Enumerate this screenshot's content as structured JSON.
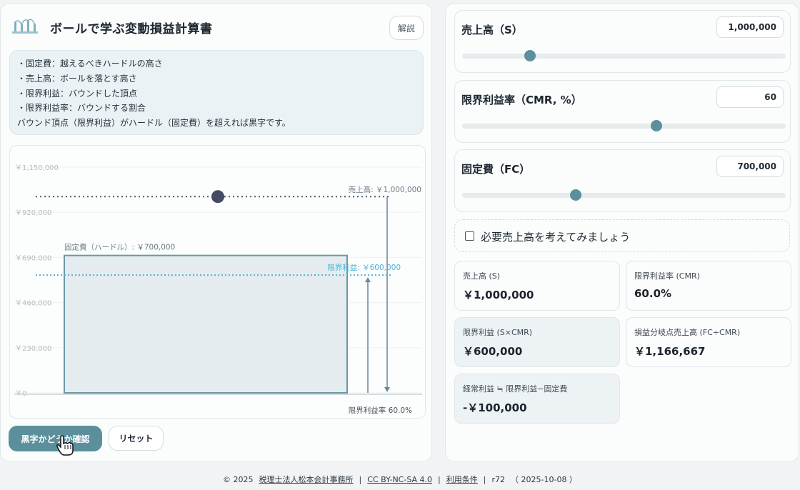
{
  "header": {
    "title": "ボールで学ぶ変動損益計算書",
    "help_label": "解説"
  },
  "info": {
    "lines": [
      "・固定費：越えるべきハードルの高さ",
      "・売上高：ボールを落とす高さ",
      "・限界利益：バウンドした頂点",
      "・限界利益率：バウンドする割合",
      "バウンド頂点（限界利益）がハードル（固定費）を超えれば黒字です。"
    ]
  },
  "chart_data": {
    "type": "bar",
    "y_ticks": [
      "￥1,150,000",
      "￥920,000",
      "￥690,000",
      "￥460,000",
      "￥230,000",
      "￥0"
    ],
    "ylim": [
      0,
      1150000
    ],
    "sales": 1000000,
    "marginal_profit": 600000,
    "fixed_cost": 700000,
    "labels": {
      "sales": "売上高: ￥1,000,000",
      "marginal_profit": "限界利益: ￥600,000",
      "fixed_cost": "固定費（ハードル）: ￥700,000",
      "cmr": "限界利益率 60.0%"
    },
    "colors": {
      "sales": "#4a5a6a",
      "marginal_profit": "#4fb3d4",
      "hurdle": "#6a98a6"
    }
  },
  "actions": {
    "check_label": "黒字かどうか確認",
    "reset_label": "リセット"
  },
  "sliders": [
    {
      "label": "売上高（S）",
      "value": "1,000,000",
      "level": 0.21
    },
    {
      "label": "限界利益率（CMR, %）",
      "value": "60",
      "level": 0.6
    },
    {
      "label": "固定費（FC）",
      "value": "700,000",
      "level": 0.35
    }
  ],
  "checkbox": {
    "label": "必要売上高を考えてみましょう",
    "checked": false
  },
  "stats": [
    {
      "label": "売上高 (S)",
      "value": "￥1,000,000"
    },
    {
      "label": "限界利益率 (CMR)",
      "value": "60.0%"
    },
    {
      "label": "限界利益 (S×CMR)",
      "value": "￥600,000"
    },
    {
      "label": "損益分岐点売上高 (FC÷CMR)",
      "value": "￥1,166,667"
    },
    {
      "label": "経常利益 ≒ 限界利益−固定費",
      "value": "-￥100,000"
    }
  ],
  "footer": {
    "copyright": "© 2025",
    "firm": "税理士法人松本会計事務所",
    "license": "CC BY-NC-SA 4.0",
    "terms": "利用条件",
    "revision": "r72",
    "date": "（ 2025-10-08 ）",
    "sep": "|"
  },
  "colors": {
    "accent": "#5b8f9c"
  }
}
